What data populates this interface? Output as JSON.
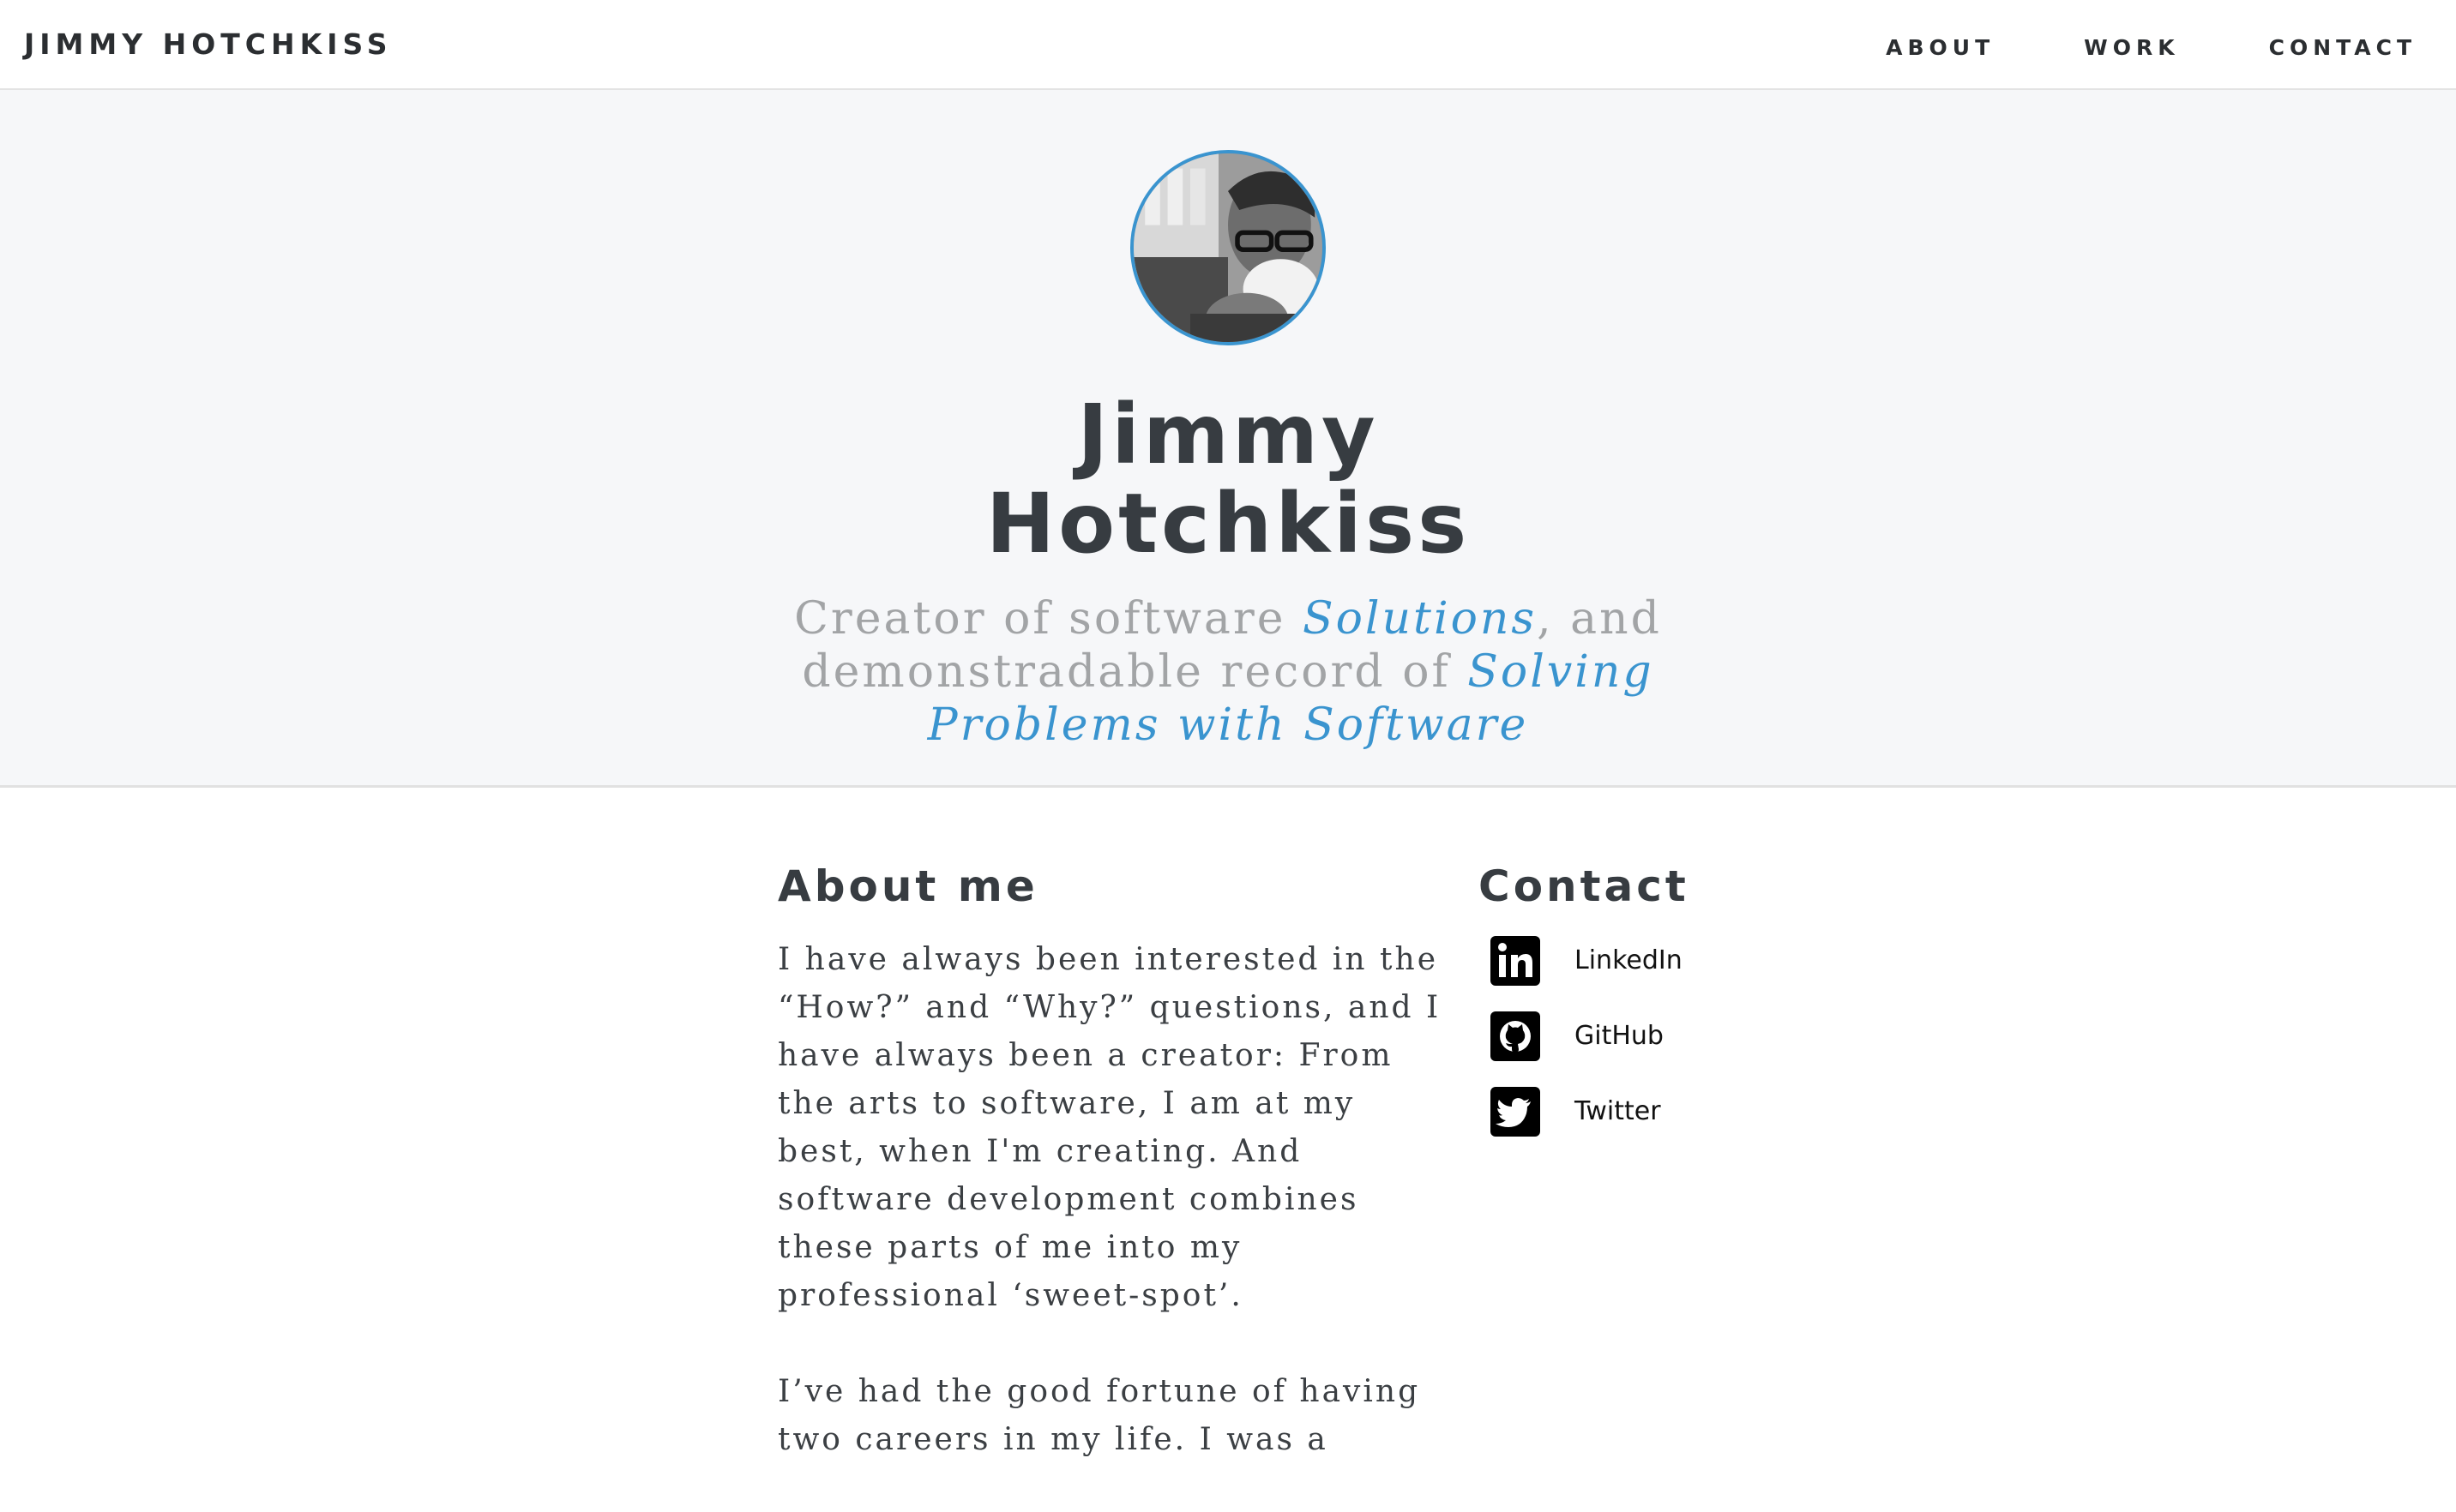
{
  "nav": {
    "brand": "JIMMY HOTCHKISS",
    "links": [
      "ABOUT",
      "WORK",
      "CONTACT"
    ]
  },
  "hero": {
    "avatar_alt": "Profile photo",
    "name_line1": "Jimmy",
    "name_line2": "Hotchkiss",
    "tagline": {
      "part1": "Creator of software ",
      "highlight1": "Solutions",
      "part2": ", and demonstradable record of ",
      "highlight2": "Solving Problems with Software"
    }
  },
  "about": {
    "title": "About me",
    "paragraphs": [
      "I have always been interested in the “How?” and “Why?” questions, and I have always been a creator: From the arts to software, I am at my best, when I'm creating. And software development combines these parts of me into my professional ‘sweet-spot’.",
      "I’ve had the good fortune of having two careers in my life. I was a"
    ]
  },
  "contact": {
    "title": "Contact",
    "items": [
      {
        "label": "LinkedIn",
        "icon": "linkedin-icon"
      },
      {
        "label": "GitHub",
        "icon": "github-icon"
      },
      {
        "label": "Twitter",
        "icon": "twitter-icon"
      }
    ]
  },
  "colors": {
    "accent": "#3a94cf",
    "heading": "#373c41",
    "muted": "#a2a4a6",
    "hero_bg": "#f6f7f9"
  }
}
